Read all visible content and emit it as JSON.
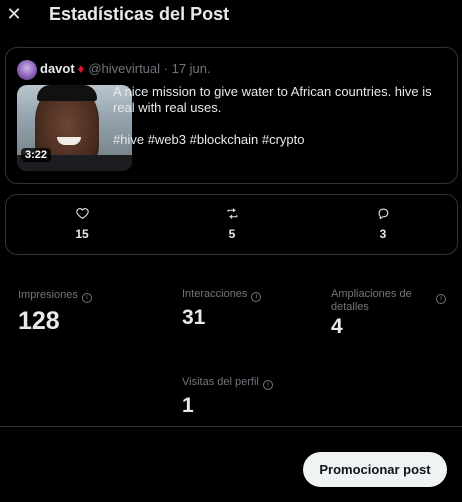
{
  "header": {
    "title": "Estadísticas del Post",
    "close_icon": "close-icon"
  },
  "post": {
    "author_name": "davot",
    "author_badge_glyph": "♦",
    "author_badge_color": "#e31337",
    "handle_date": "@hivevirtual · 17 jun.",
    "text": "A nice mission to give water to African countries. hive is real with real uses.",
    "hashtags": "#hive #web3 #blockchain #crypto",
    "video_duration": "3:22"
  },
  "engagement": {
    "likes": "15",
    "reposts": "5",
    "replies": "3"
  },
  "metrics": {
    "impressions_label": "Impresiones",
    "impressions_value": "128",
    "interactions_label": "Interacciones",
    "interactions_value": "31",
    "expansions_label_1": "Ampliaciones de",
    "expansions_label_2": "detalles",
    "expansions_value": "4",
    "profile_visits_label": "Visitas del perfil",
    "profile_visits_value": "1"
  },
  "footer": {
    "promote_label": "Promocionar post"
  },
  "colors": {
    "background": "#000000",
    "text": "#e7e9ea",
    "muted": "#71767b",
    "border": "#2f3336",
    "button_bg": "#eff3f4"
  }
}
